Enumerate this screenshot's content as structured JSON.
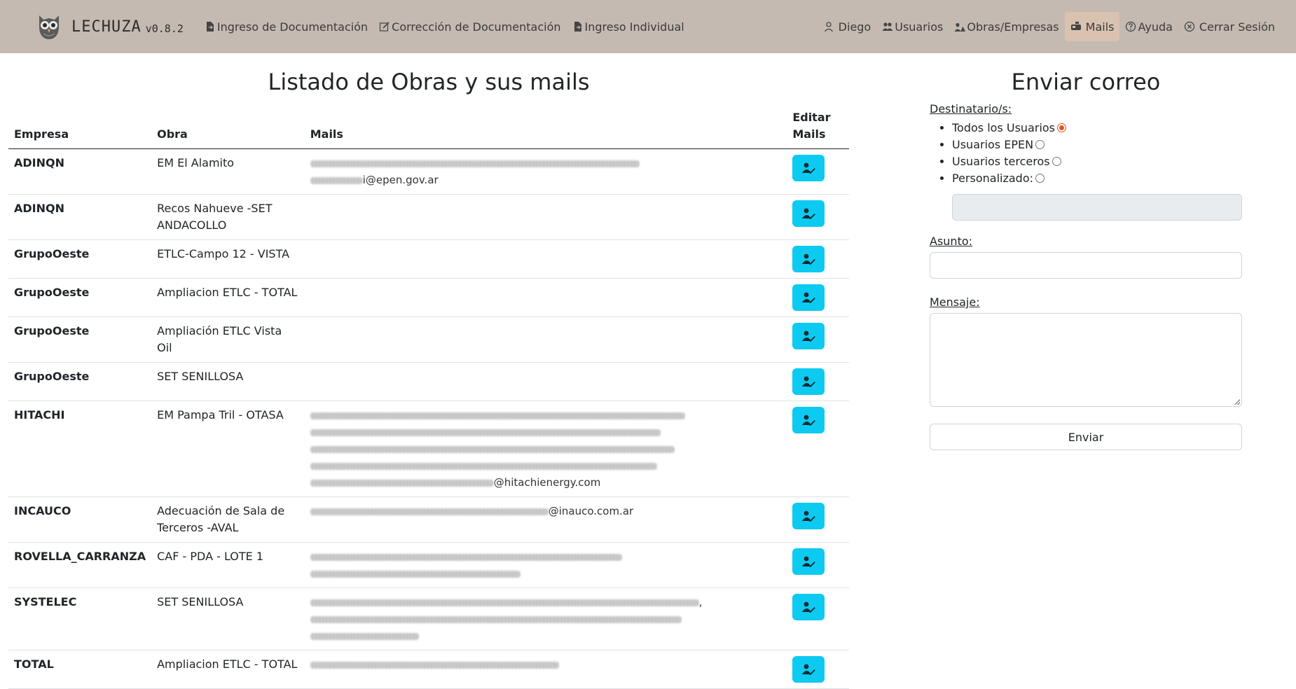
{
  "nav": {
    "brand_name": "LECHUZA",
    "brand_version": "v0.8.2",
    "left_items": [
      {
        "label": "Ingreso de Documentación",
        "icon": "file-arrow-icon"
      },
      {
        "label": "Corrección de Documentación",
        "icon": "pencil-square-icon"
      },
      {
        "label": "Ingreso Individual",
        "icon": "file-arrow-icon"
      }
    ],
    "right_items": [
      {
        "label": "Diego",
        "icon": "person-icon"
      },
      {
        "label": "Usuarios",
        "icon": "people-icon"
      },
      {
        "label": "Obras/Empresas",
        "icon": "workers-icon"
      },
      {
        "label": "Mails",
        "icon": "mailbox-icon",
        "active": true
      },
      {
        "label": "Ayuda",
        "icon": "question-circle-icon"
      },
      {
        "label": "Cerrar Sesión",
        "icon": "x-circle-icon"
      }
    ]
  },
  "listado": {
    "title": "Listado de Obras y sus mails",
    "headers": {
      "empresa": "Empresa",
      "obra": "Obra",
      "mails": "Mails",
      "editar_1": "Editar",
      "editar_2": "Mails"
    },
    "rows": [
      {
        "empresa": "ADINQN",
        "obra": "EM El Alamito",
        "mails": [
          {
            "blur": 470,
            "text": ""
          },
          {
            "blur": 75,
            "text": "i@epen.gov.ar"
          }
        ]
      },
      {
        "empresa": "ADINQN",
        "obra": "Recos Nahueve -SET ANDACOLLO",
        "mails": []
      },
      {
        "empresa": "GrupoOeste",
        "obra": "ETLC-Campo 12 - VISTA",
        "mails": []
      },
      {
        "empresa": "GrupoOeste",
        "obra": "Ampliacion ETLC - TOTAL",
        "mails": []
      },
      {
        "empresa": "GrupoOeste",
        "obra": "Ampliación ETLC Vista Oil",
        "mails": []
      },
      {
        "empresa": "GrupoOeste",
        "obra": "SET SENILLOSA",
        "mails": []
      },
      {
        "empresa": "HITACHI",
        "obra": "EM Pampa Tril - OTASA",
        "mails": [
          {
            "blur": 535,
            "text": ""
          },
          {
            "blur": 500,
            "text": ""
          },
          {
            "blur": 520,
            "text": ""
          },
          {
            "blur": 495,
            "text": ""
          },
          {
            "blur": 262,
            "text": "@hitachienergy.com"
          }
        ]
      },
      {
        "empresa": "INCAUCO",
        "obra": "Adecuación de Sala de Terceros -AVAL",
        "mails": [
          {
            "blur": 340,
            "text": "@inauco.com.ar"
          }
        ]
      },
      {
        "empresa": "ROVELLA_CARRANZA",
        "obra": "CAF - PDA - LOTE 1",
        "mails": [
          {
            "blur": 445,
            "text": ""
          },
          {
            "blur": 300,
            "text": ""
          }
        ]
      },
      {
        "empresa": "SYSTELEC",
        "obra": "SET SENILLOSA",
        "mails": [
          {
            "blur": 555,
            "text": ","
          },
          {
            "blur": 530,
            "text": ""
          },
          {
            "blur": 155,
            "text": ""
          }
        ]
      },
      {
        "empresa": "TOTAL",
        "obra": "Ampliacion ETLC - TOTAL",
        "mails": [
          {
            "blur": 355,
            "text": ""
          }
        ]
      }
    ]
  },
  "enviar": {
    "title": "Enviar correo",
    "destinatarios_label": "Destinatario/s:",
    "options": [
      {
        "label": "Todos los Usuarios",
        "checked": true
      },
      {
        "label": "Usuarios EPEN",
        "checked": false
      },
      {
        "label": "Usuarios terceros",
        "checked": false
      },
      {
        "label": "Personalizado:",
        "checked": false
      }
    ],
    "asunto_label": "Asunto:",
    "mensaje_label": "Mensaje:",
    "send_label": "Enviar"
  },
  "colors": {
    "navbar_bg": "#c4bab1",
    "active_nav_bg": "#d9c2b0",
    "edit_button": "#0dcaf0",
    "radio_accent": "#e0551f"
  }
}
